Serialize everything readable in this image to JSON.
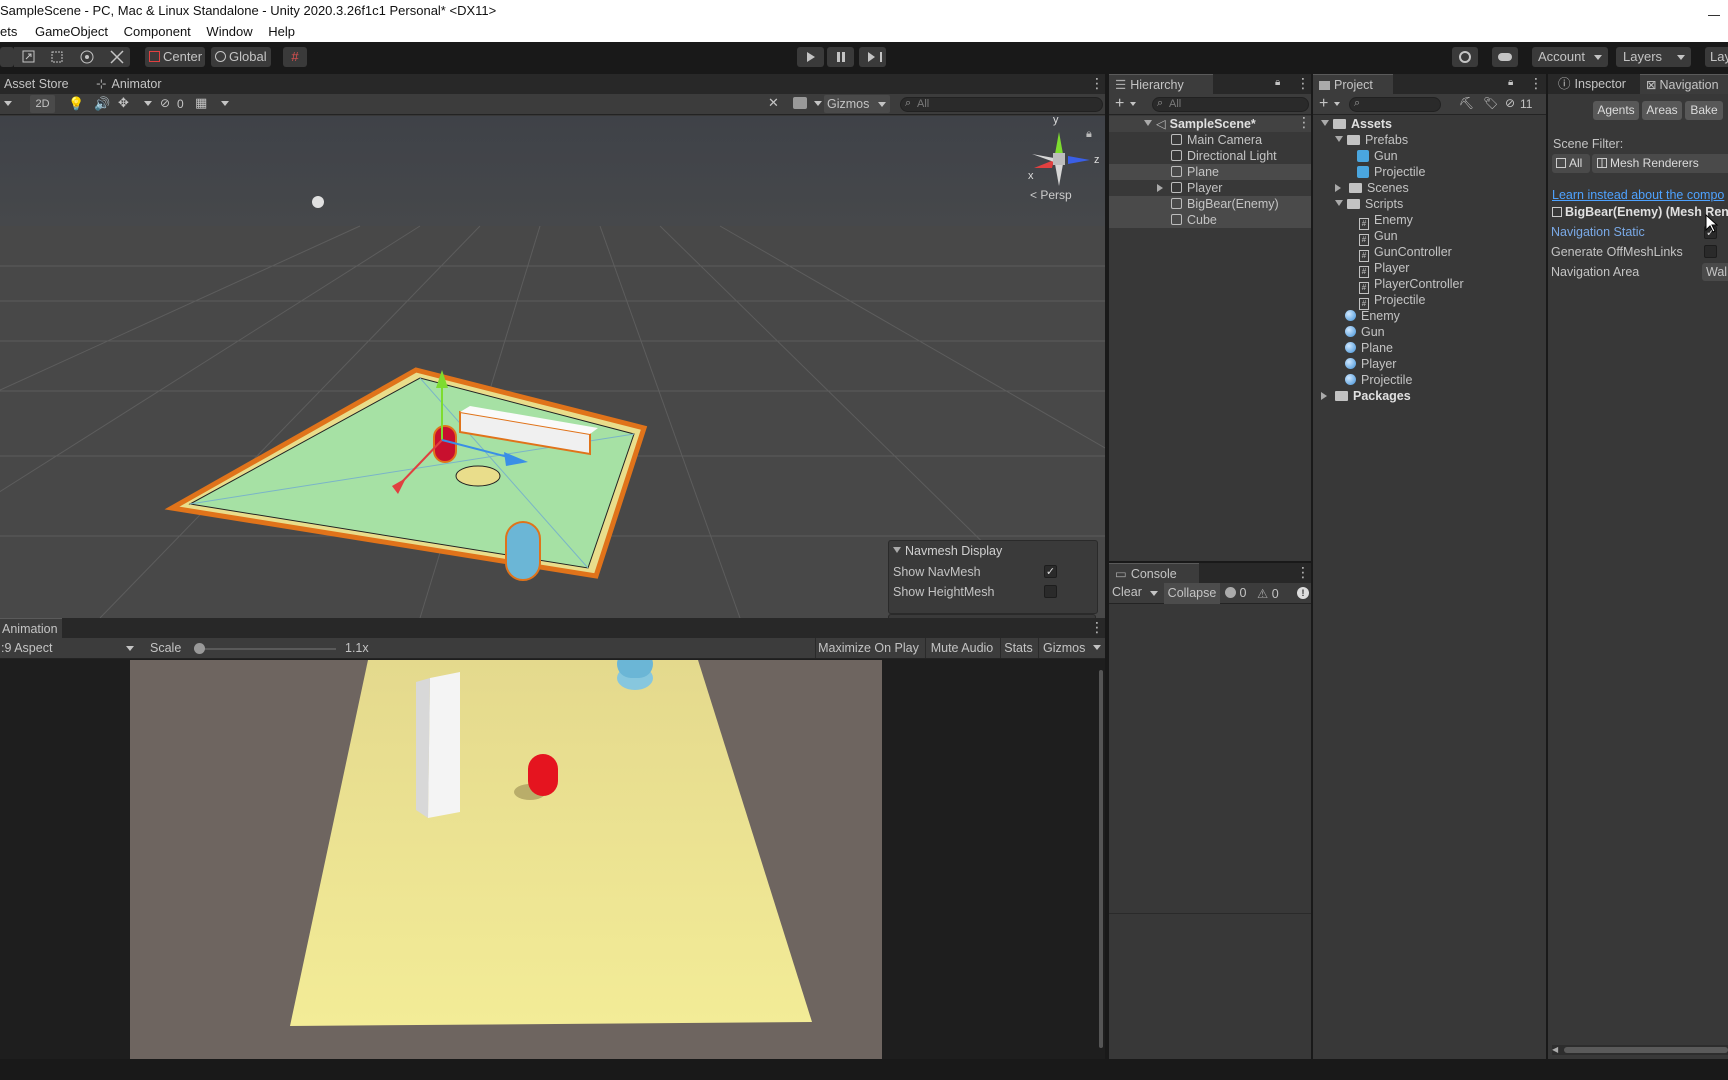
{
  "window": {
    "title": "SampleScene - PC, Mac & Linux Standalone - Unity 2020.3.26f1c1 Personal* <DX11>"
  },
  "menu": [
    "ets",
    "GameObject",
    "Component",
    "Window",
    "Help"
  ],
  "toolbar": {
    "center": "Center",
    "global": "Global",
    "account": "Account",
    "layers": "Layers",
    "layout": "Lay",
    "collab_count": "11"
  },
  "scene": {
    "tabs": [
      "Asset Store",
      "Animator"
    ],
    "mode_2d": "2D",
    "hidden_count": "0",
    "gizmos": "Gizmos",
    "search_placeholder": "All",
    "persp": "Persp",
    "axis_y": "y",
    "axis_z": "z",
    "axis_x": "x",
    "navmesh": {
      "title": "Navmesh Display",
      "show_navmesh": "Show NavMesh",
      "show_heightmesh": "Show HeightMesh",
      "navmesh_checked": true,
      "heightmesh_checked": false
    }
  },
  "game": {
    "tab": "Animation",
    "aspect": ":9 Aspect",
    "scale_label": "Scale",
    "scale_value": "1.1x",
    "maximize": "Maximize On Play",
    "mute": "Mute Audio",
    "stats": "Stats",
    "gizmos": "Gizmos"
  },
  "hierarchy": {
    "tab": "Hierarchy",
    "search_placeholder": "All",
    "scene_name": "SampleScene*",
    "items": [
      "Main Camera",
      "Directional Light",
      "Plane",
      "Player",
      "BigBear(Enemy)",
      "Cube"
    ]
  },
  "console": {
    "tab": "Console",
    "clear": "Clear",
    "collapse": "Collapse",
    "info_count": "0",
    "warn_count": "0"
  },
  "project": {
    "tab": "Project",
    "assets": "Assets",
    "prefabs": "Prefabs",
    "prefab_items": [
      "Gun",
      "Projectile"
    ],
    "scenes": "Scenes",
    "scripts": "Scripts",
    "script_items": [
      "Enemy",
      "Gun",
      "GunController",
      "Player",
      "PlayerController",
      "Projectile"
    ],
    "material_items": [
      "Enemy",
      "Gun",
      "Plane",
      "Player",
      "Projectile"
    ],
    "packages": "Packages"
  },
  "inspector": {
    "tab_inspector": "Inspector",
    "tab_navigation": "Navigation",
    "agents": "Agents",
    "areas": "Areas",
    "bake": "Bake",
    "scene_filter": "Scene Filter:",
    "filter_all": "All",
    "filter_mesh": "Mesh Renderers",
    "learn_link": "Learn instead about the compo",
    "object_name": "BigBear(Enemy) (Mesh Ren",
    "nav_static": "Navigation Static",
    "gen_offmesh": "Generate OffMeshLinks",
    "nav_area": "Navigation Area",
    "nav_area_value": "Wal"
  }
}
